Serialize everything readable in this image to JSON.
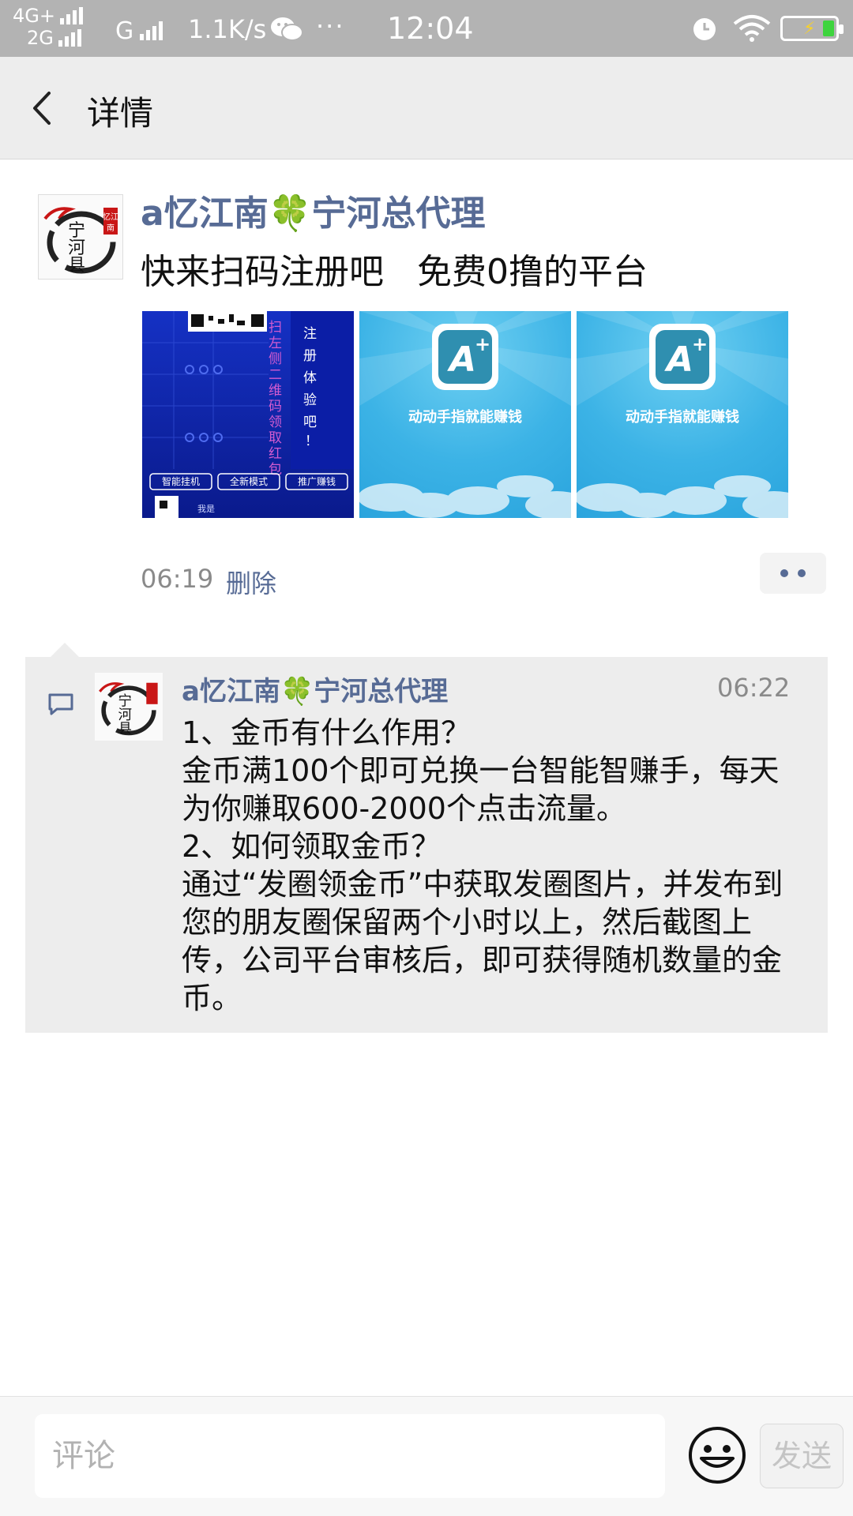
{
  "status_bar": {
    "network_top": "4G+",
    "network_bottom": "2G",
    "network_g": "G",
    "speed": "1.1K/s",
    "dots": "···",
    "time": "12:04"
  },
  "nav": {
    "title": "详情"
  },
  "post": {
    "author": "a忆江南🍀宁河总代理",
    "text": "快来扫码注册吧   免费0撸的平台",
    "time": "06:19",
    "delete_label": "删除",
    "avatar_text": "宁河县",
    "avatar_seal": "忆江南",
    "images": [
      {
        "side_text": "扫左侧二维码领取红包",
        "vertical_text": "注册体验吧！",
        "buttons": [
          "智能挂机",
          "全新模式",
          "推广赚钱"
        ],
        "footer": "我是"
      },
      {
        "caption": "动动手指就能赚钱",
        "logo": "A+"
      },
      {
        "caption": "动动手指就能赚钱",
        "logo": "A+"
      }
    ]
  },
  "comment": {
    "author": "a忆江南🍀宁河总代理",
    "time": "06:22",
    "lines": [
      "1、金币有什么作用？",
      "金币满100个即可兑换一台智能智赚手，每天为你赚取600-2000个点击流量。",
      "2、如何领取金币？",
      "通过“发圈领金币”中获取发圈图片，并发布到您的朋友圈保留两个小时以上，然后截图上传，公司平台审核后，即可获得随机数量的金币。"
    ]
  },
  "input": {
    "placeholder": "评论",
    "send_label": "发送"
  },
  "colors": {
    "link": "#576b95",
    "status_bar": "#b3b3b3",
    "nav_bg": "#ededed",
    "comment_bg": "#ededed"
  },
  "icons": {
    "back": "chevron-left-icon",
    "comment": "speech-bubble-icon",
    "emoji": "smiley-icon",
    "more": "two-dots-icon"
  }
}
